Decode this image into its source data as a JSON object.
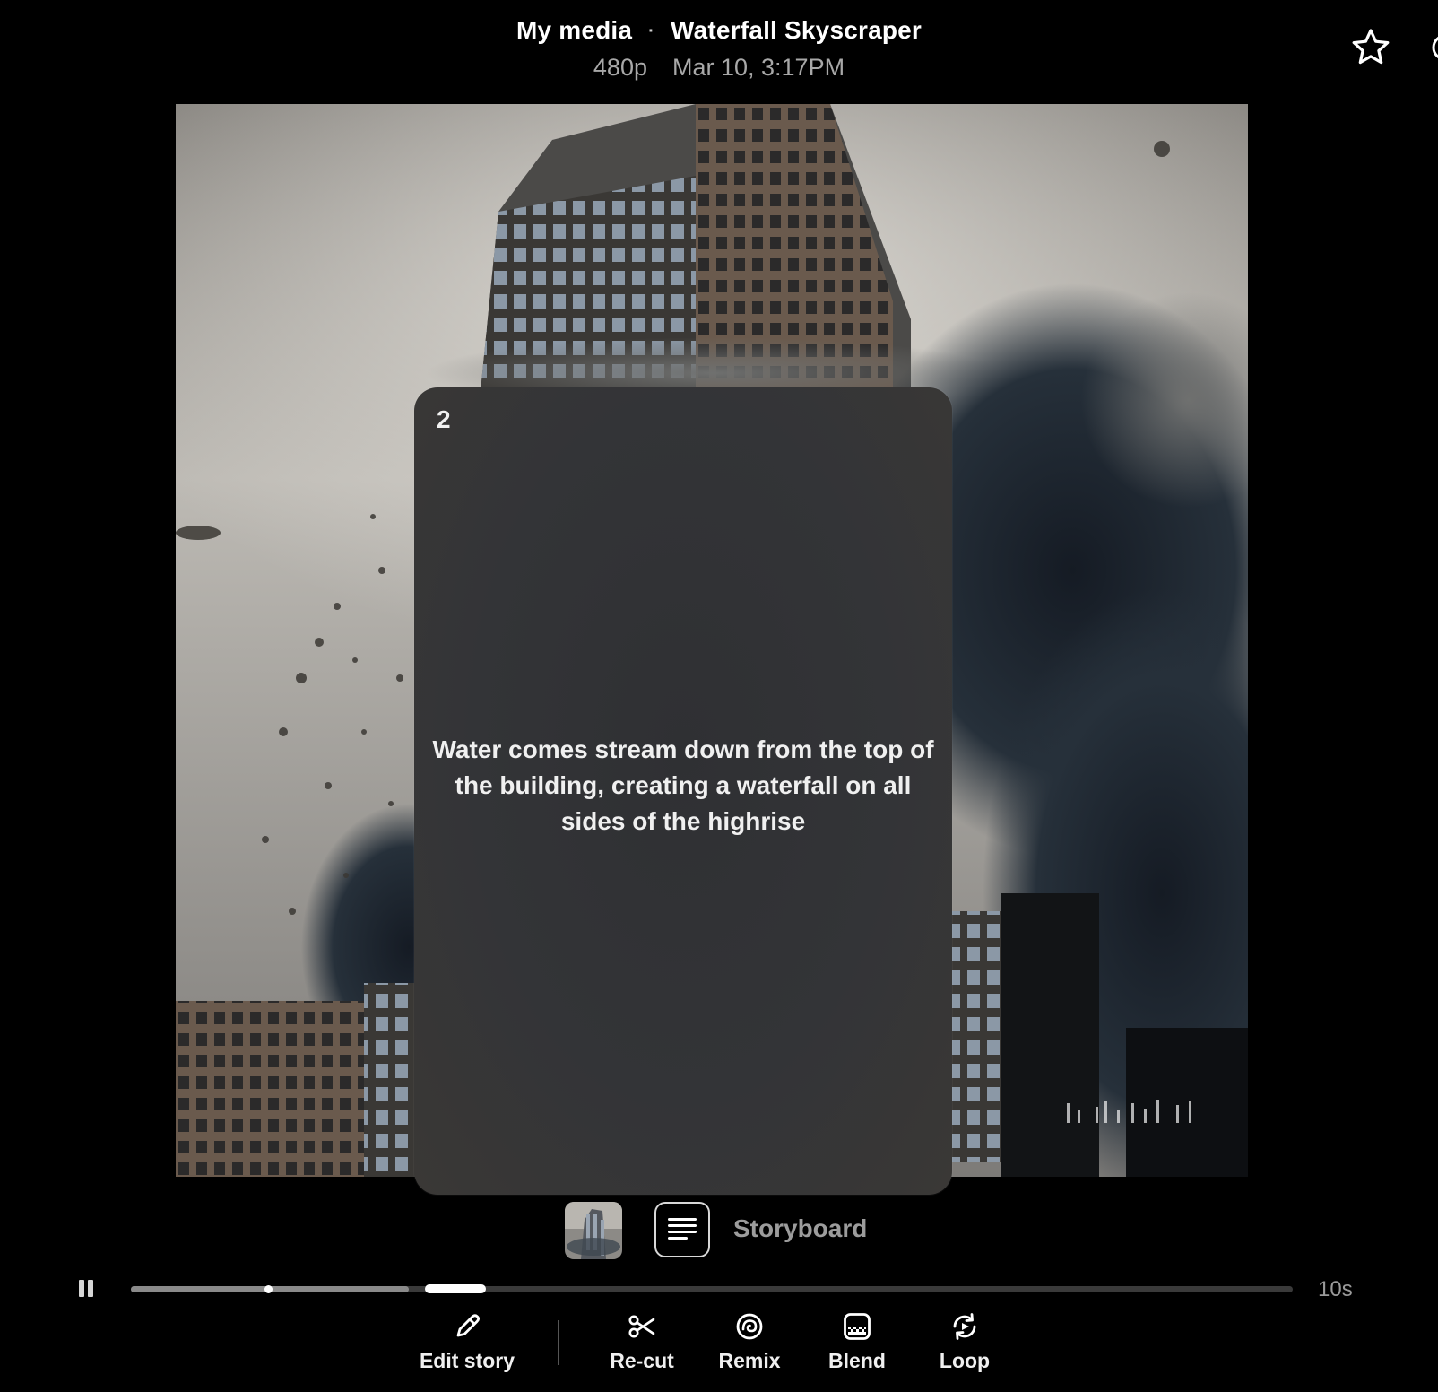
{
  "header": {
    "breadcrumb_parent": "My media",
    "separator": "·",
    "title": "Waterfall Skyscraper",
    "resolution": "480p",
    "timestamp": "Mar 10, 3:17PM",
    "favorite_icon": "star-icon"
  },
  "card": {
    "number": "2",
    "prompt": "Water comes stream down from the top of the building, creating a waterfall on all sides of the highrise"
  },
  "storyboard": {
    "label": "Storyboard",
    "thumbnail_icon": "video-thumbnail",
    "text_card_icon": "text-lines-icon"
  },
  "player": {
    "state": "playing",
    "pause_icon": "pause-icon",
    "duration": "10s",
    "progress_fraction": 0.118,
    "active_segment": 2
  },
  "toolbar": {
    "items": [
      {
        "label": "Edit story",
        "icon": "pencil-icon"
      },
      {
        "label": "Re-cut",
        "icon": "scissors-icon"
      },
      {
        "label": "Remix",
        "icon": "remix-icon"
      },
      {
        "label": "Blend",
        "icon": "blend-icon"
      },
      {
        "label": "Loop",
        "icon": "loop-icon"
      }
    ]
  },
  "colors": {
    "background": "#000000",
    "card": "#333437",
    "text": "#ffffff",
    "muted_text": "#a8a8a8"
  }
}
